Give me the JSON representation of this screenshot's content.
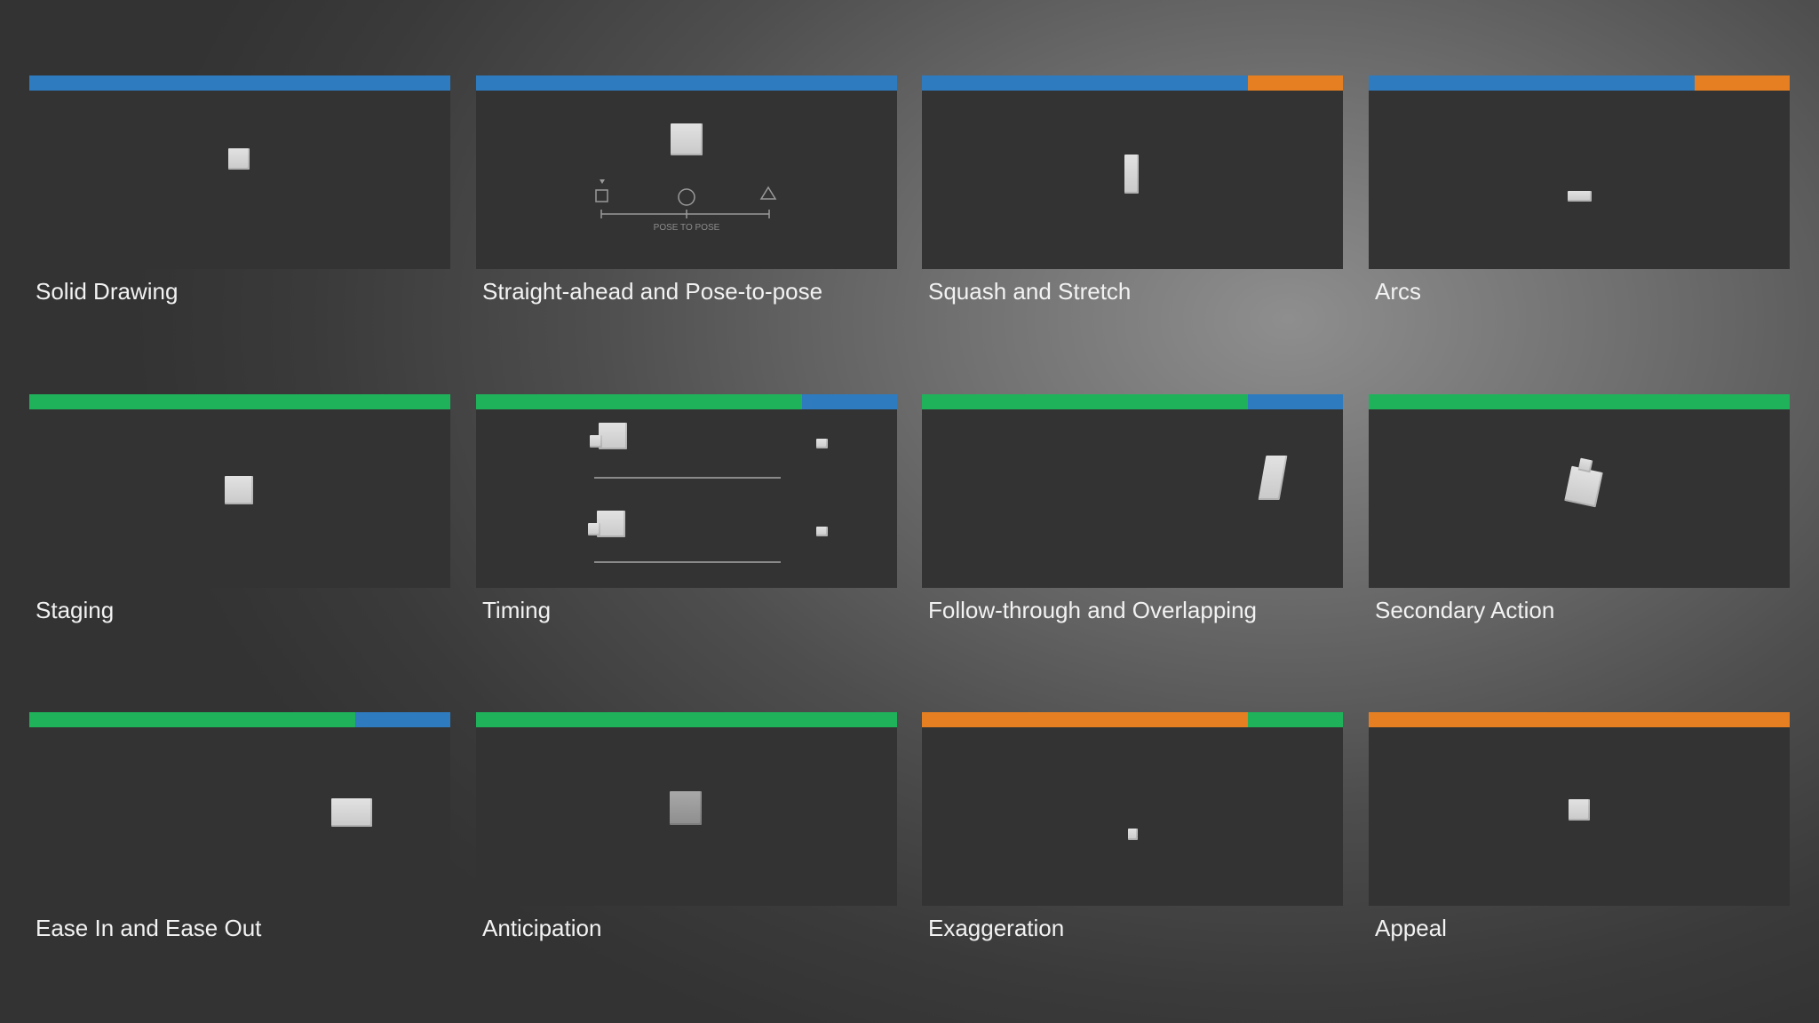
{
  "colors": {
    "blue": "#2e7bbf",
    "orange": "#e57f22",
    "green": "#1fb25a",
    "panel": "#333334"
  },
  "cards": [
    {
      "title": "Solid Drawing",
      "bar": [
        {
          "color": "blue",
          "fraction": 1.0
        }
      ]
    },
    {
      "title": "Straight-ahead and Pose-to-pose",
      "bar": [
        {
          "color": "blue",
          "fraction": 1.0
        }
      ],
      "diagram_label": "POSE TO POSE"
    },
    {
      "title": "Squash and Stretch",
      "bar": [
        {
          "color": "blue",
          "fraction": 0.775
        },
        {
          "color": "orange",
          "fraction": 0.225
        }
      ]
    },
    {
      "title": "Arcs",
      "bar": [
        {
          "color": "blue",
          "fraction": 0.775
        },
        {
          "color": "orange",
          "fraction": 0.225
        }
      ]
    },
    {
      "title": "Staging",
      "bar": [
        {
          "color": "green",
          "fraction": 1.0
        }
      ]
    },
    {
      "title": "Timing",
      "bar": [
        {
          "color": "green",
          "fraction": 0.775
        },
        {
          "color": "blue",
          "fraction": 0.225
        }
      ]
    },
    {
      "title": "Follow-through and Overlapping",
      "bar": [
        {
          "color": "green",
          "fraction": 0.775
        },
        {
          "color": "blue",
          "fraction": 0.225
        }
      ]
    },
    {
      "title": "Secondary Action",
      "bar": [
        {
          "color": "green",
          "fraction": 1.0
        }
      ]
    },
    {
      "title": "Ease In and Ease Out",
      "bar": [
        {
          "color": "green",
          "fraction": 0.775
        },
        {
          "color": "blue",
          "fraction": 0.225
        }
      ]
    },
    {
      "title": "Anticipation",
      "bar": [
        {
          "color": "green",
          "fraction": 1.0
        }
      ]
    },
    {
      "title": "Exaggeration",
      "bar": [
        {
          "color": "orange",
          "fraction": 0.775
        },
        {
          "color": "green",
          "fraction": 0.225
        }
      ]
    },
    {
      "title": "Appeal",
      "bar": [
        {
          "color": "orange",
          "fraction": 1.0
        }
      ]
    }
  ]
}
